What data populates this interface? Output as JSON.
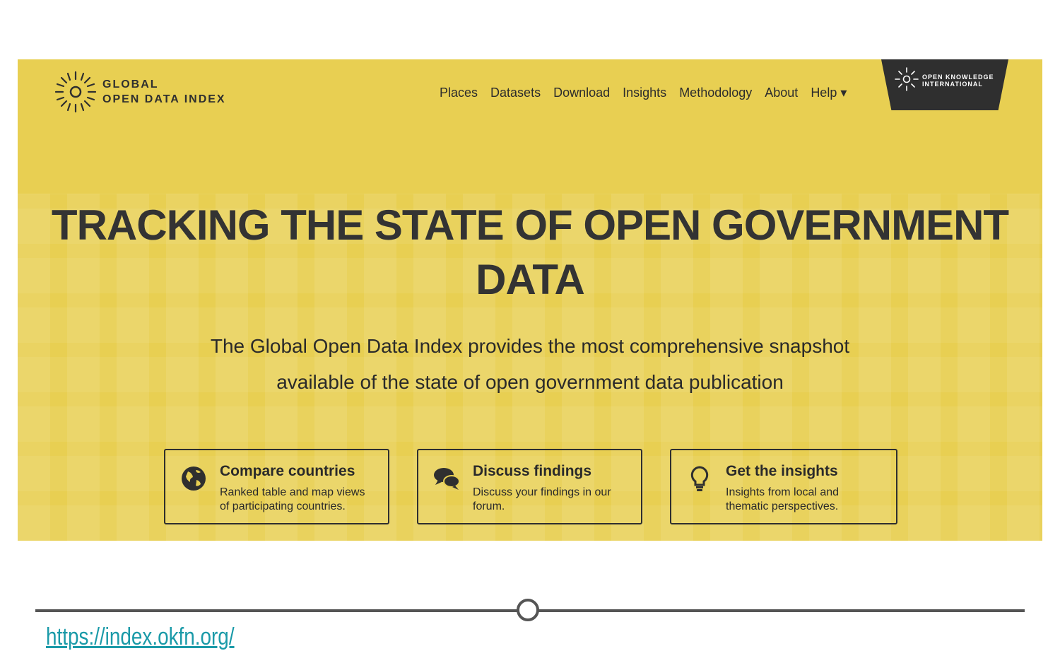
{
  "brand": {
    "line1": "GLOBAL",
    "line2": "OPEN DATA INDEX"
  },
  "nav": {
    "items": [
      {
        "label": "Places"
      },
      {
        "label": "Datasets"
      },
      {
        "label": "Download"
      },
      {
        "label": "Insights"
      },
      {
        "label": "Methodology"
      },
      {
        "label": "About"
      },
      {
        "label": "Help ▾"
      }
    ]
  },
  "okfn": {
    "line1": "OPEN KNOWLEDGE",
    "line2": "INTERNATIONAL"
  },
  "hero": {
    "title_line1": "TRACKING THE STATE OF OPEN GOVERNMENT",
    "title_line2": "DATA",
    "subtitle_line1": "The Global Open Data Index provides the most comprehensive snapshot",
    "subtitle_line2": "available of the state of open government data publication"
  },
  "cards": [
    {
      "icon": "globe-icon",
      "title": "Compare countries",
      "desc_line1": "Ranked table and map views",
      "desc_line2": "of participating countries."
    },
    {
      "icon": "chat-bubbles-icon",
      "title": "Discuss findings",
      "desc_line1": "Discuss your findings in our",
      "desc_line2": "forum."
    },
    {
      "icon": "lightbulb-icon",
      "title": "Get the insights",
      "desc_line1": "Insights from local and",
      "desc_line2": "thematic perspectives."
    }
  ],
  "footer": {
    "url": "https://index.okfn.org/"
  },
  "colors": {
    "hero_bg": "#e8cf52",
    "text_dark": "#333333",
    "link": "#1a9aa8"
  }
}
